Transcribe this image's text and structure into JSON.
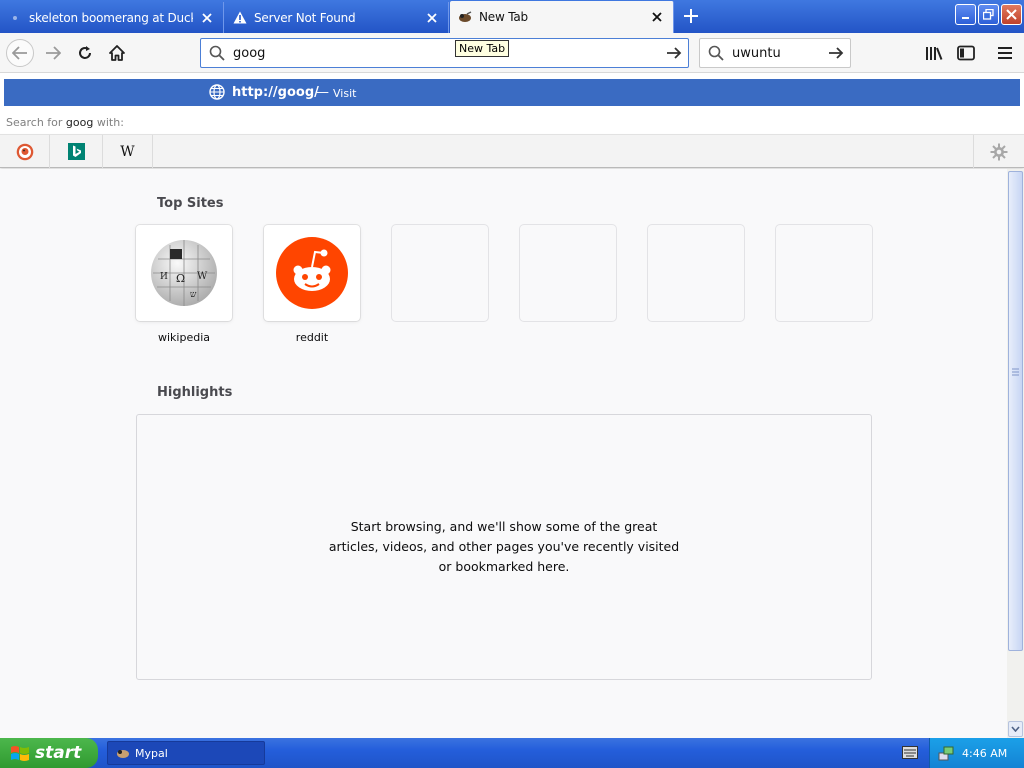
{
  "tabs": [
    {
      "title": "skeleton boomerang at DuckDuckGo",
      "icon": "duckduckgo-icon",
      "active": false
    },
    {
      "title": "Server Not Found",
      "icon": "warning-icon",
      "active": false
    },
    {
      "title": "New Tab",
      "icon": "mypal-icon",
      "active": true
    }
  ],
  "tooltip": "New Tab",
  "urlbar": {
    "value": "goog"
  },
  "searchbar": {
    "value": "uwuntu"
  },
  "autocomplete": {
    "url": "http://goog/",
    "dash": "—",
    "action": "Visit"
  },
  "oneoff": {
    "label_prefix": "Search for ",
    "query": "goog",
    "label_suffix": " with:",
    "engines": [
      "duckduckgo",
      "bing",
      "wikipedia"
    ],
    "wikipedia_letter": "W"
  },
  "topsites": {
    "title": "Top Sites",
    "sites": [
      {
        "label": "wikipedia",
        "icon": "wikipedia-globe-icon"
      },
      {
        "label": "reddit",
        "icon": "reddit-icon"
      }
    ],
    "empty_slots": 4
  },
  "highlights": {
    "title": "Highlights",
    "message": "Start browsing, and we'll show some of the great articles, videos, and other pages you've recently visited or bookmarked here."
  },
  "taskbar": {
    "start": "start",
    "task": "Mypal",
    "time": "4:46 AM"
  },
  "colors": {
    "accent": "#3a6bc2",
    "reddit": "#ff4500",
    "start_green": "#3ca63c"
  }
}
